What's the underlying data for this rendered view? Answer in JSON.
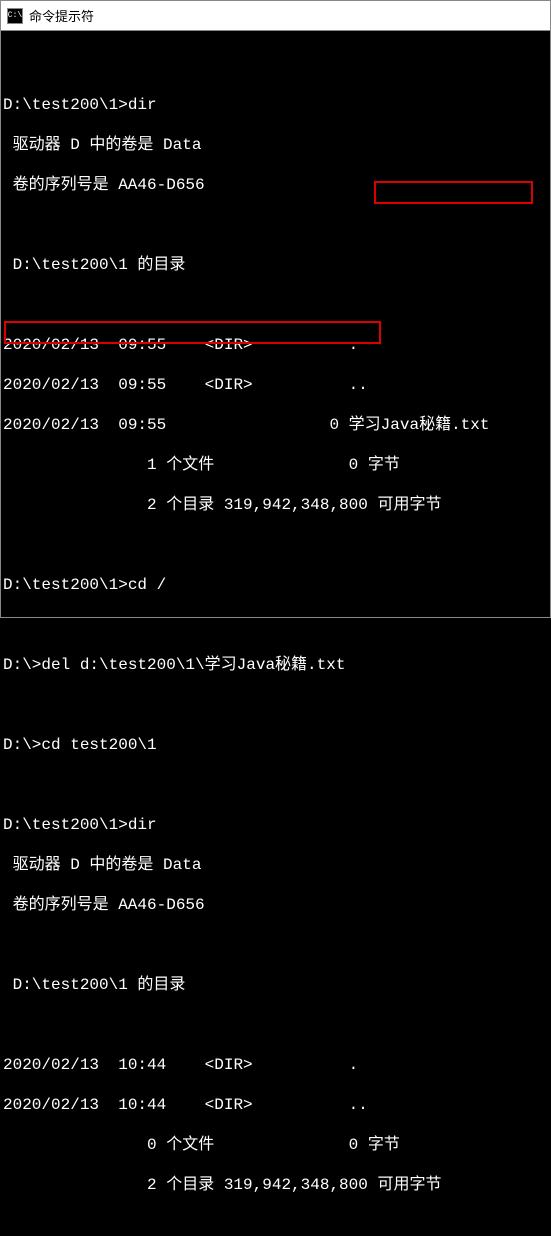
{
  "window": {
    "icon_text": "C:\\",
    "title": "命令提示符"
  },
  "lines": {
    "l0": "",
    "l1": "D:\\test200\\1>dir",
    "l2": " 驱动器 D 中的卷是 Data",
    "l3": " 卷的序列号是 AA46-D656",
    "l4": "",
    "l5": " D:\\test200\\1 的目录",
    "l6": "",
    "l7": "2020/02/13  09:55    <DIR>          .",
    "l8": "2020/02/13  09:55    <DIR>          ..",
    "l9": "2020/02/13  09:55                 0 学习Java秘籍.txt",
    "l10": "               1 个文件              0 字节",
    "l11": "               2 个目录 319,942,348,800 可用字节",
    "l12": "",
    "l13": "D:\\test200\\1>cd /",
    "l14": "",
    "l15": "D:\\>del d:\\test200\\1\\学习Java秘籍.txt",
    "l16": "",
    "l17": "D:\\>cd test200\\1",
    "l18": "",
    "l19": "D:\\test200\\1>dir",
    "l20": " 驱动器 D 中的卷是 Data",
    "l21": " 卷的序列号是 AA46-D656",
    "l22": "",
    "l23": " D:\\test200\\1 的目录",
    "l24": "",
    "l25": "2020/02/13  10:44    <DIR>          .",
    "l26": "2020/02/13  10:44    <DIR>          ..",
    "l27": "               0 个文件              0 字节",
    "l28": "               2 个目录 319,942,348,800 可用字节"
  }
}
